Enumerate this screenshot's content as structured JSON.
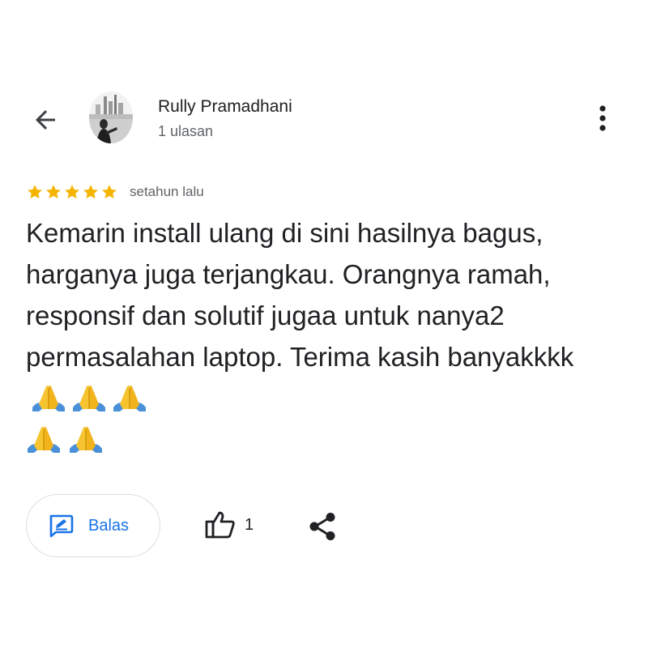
{
  "header": {
    "reviewer_name": "Rully Pramadhani",
    "review_count": "1 ulasan",
    "back_icon": "arrow-back-icon",
    "more_icon": "more-vert-icon"
  },
  "review": {
    "rating": 5,
    "max_rating": 5,
    "time": "setahun lalu",
    "text": "Kemarin install ulang di sini hasilnya bagus, harganya juga terjangkau. Orangnya ramah, responsif dan solutif jugaa untuk nanya2 permasalahan laptop. Terima kasih banyakkkk",
    "emoji_count": 5,
    "emoji": "🙏"
  },
  "actions": {
    "reply_label": "Balas",
    "like_count": "1",
    "reply_icon": "reply-icon",
    "like_icon": "thumbs-up-icon",
    "share_icon": "share-icon"
  },
  "colors": {
    "star": "#f4b400",
    "accent": "#1a73e8",
    "text": "#202124",
    "secondary": "#5f6368"
  }
}
